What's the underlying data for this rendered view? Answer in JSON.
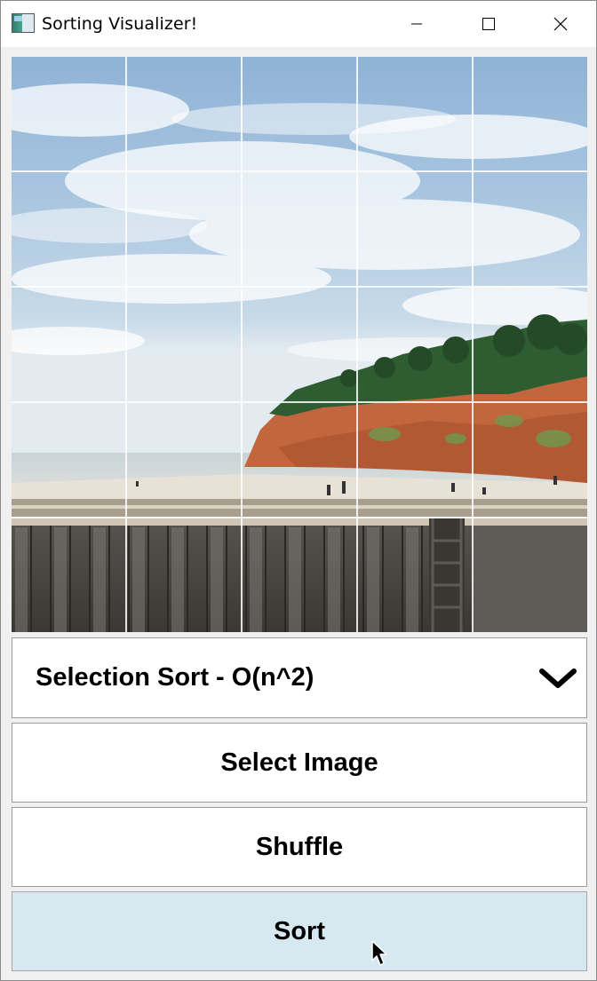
{
  "window": {
    "title": "Sorting Visualizer!",
    "app_icon": "app-window-icon",
    "controls": {
      "minimize_icon": "minimize-icon",
      "maximize_icon": "maximize-icon",
      "close_icon": "close-icon"
    }
  },
  "image_grid": {
    "rows": 5,
    "columns": 5,
    "description_icon": "beach-cliff-photo"
  },
  "algorithm_select": {
    "selected": "Selection Sort - O(n^2)",
    "icon": "chevron-down-icon"
  },
  "buttons": {
    "select_image": "Select Image",
    "shuffle": "Shuffle",
    "sort": "Sort"
  },
  "colors": {
    "sort_button_bg": "#d6e9f0",
    "button_bg": "#ffffff",
    "window_bg": "#f0f0f0"
  }
}
